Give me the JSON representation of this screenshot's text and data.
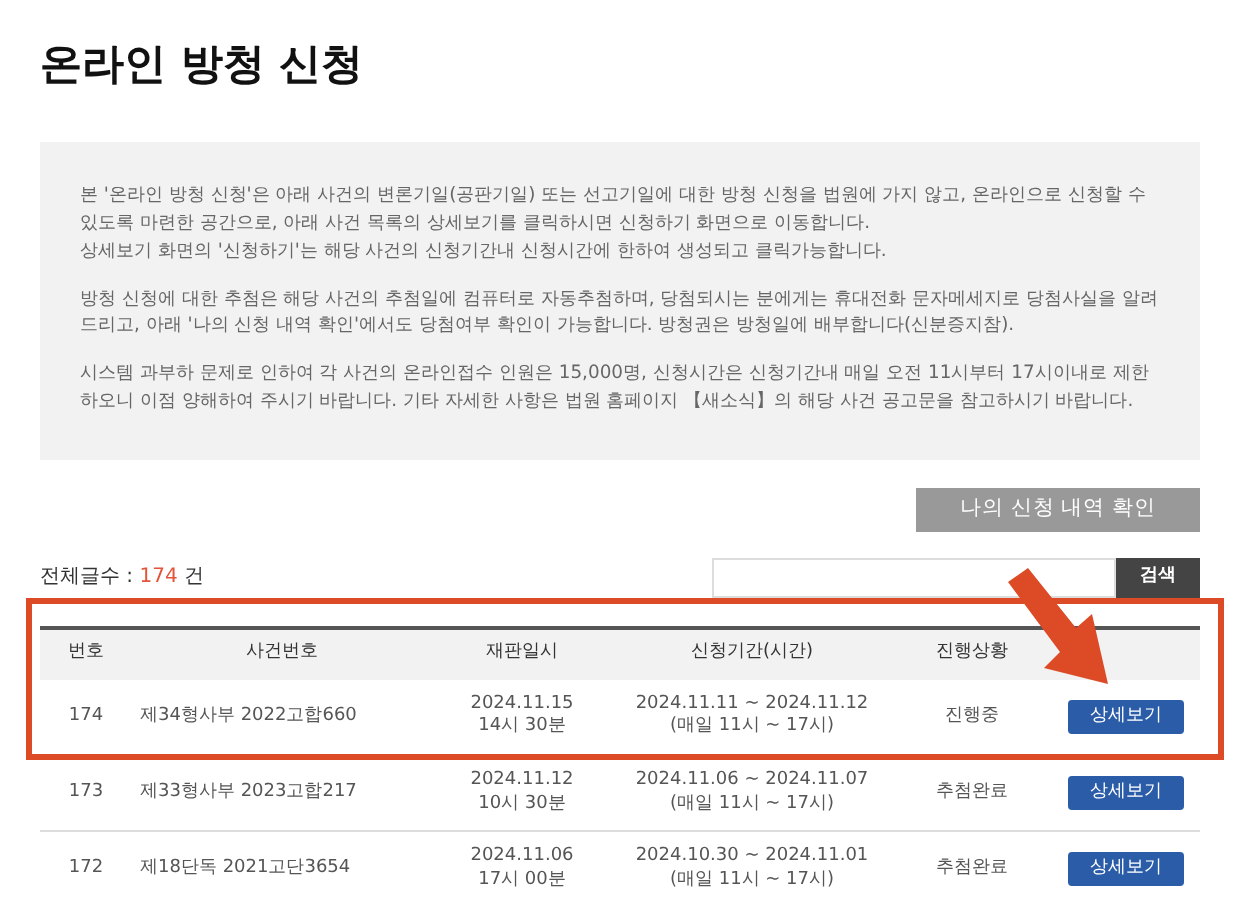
{
  "page_title": "온라인 방청 신청",
  "notice": {
    "paragraphs": [
      [
        "본 '온라인 방청 신청'은 아래 사건의 변론기일(공판기일) 또는 선고기일에 대한 방청 신청을 법원에 가지 않고, 온라인으로 신청할 수 있도록 마련한 공간으로, 아래 사건 목록의 상세보기를 클릭하시면 신청하기 화면으로 이동합니다.",
        "상세보기 화면의 '신청하기'는 해당 사건의 신청기간내 신청시간에 한하여 생성되고 클릭가능합니다."
      ],
      [
        "방청 신청에 대한 추첨은 해당 사건의 추첨일에 컴퓨터로 자동추첨하며, 당첨되시는 분에게는 휴대전화 문자메세지로 당첨사실을 알려드리고, 아래 '나의 신청 내역 확인'에서도 당첨여부 확인이 가능합니다. 방청권은 방청일에 배부합니다(신분증지참)."
      ],
      [
        "시스템 과부하 문제로 인하여 각 사건의 온라인접수 인원은 15,000명, 신청시간은 신청기간내 매일 오전 11시부터 17시이내로 제한하오니 이점 양해하여 주시기 바랍니다. 기타 자세한 사항은 법원 홈페이지 【새소식】의 해당 사건 공고문을 참고하시기 바랍니다."
      ]
    ]
  },
  "my_requests_button": "나의 신청 내역 확인",
  "total": {
    "label": "전체글수 :",
    "count": "174",
    "unit": "건"
  },
  "search": {
    "button": "검색"
  },
  "table": {
    "columns": [
      "번호",
      "사건번호",
      "재판일시",
      "신청기간(시간)",
      "진행상황"
    ],
    "rows": [
      {
        "no": "174",
        "case": "제34형사부 2022고합660",
        "trial": [
          "2024.11.15",
          "14시 30분"
        ],
        "period": [
          "2024.11.11 ~ 2024.11.12",
          "(매일 11시 ~ 17시)"
        ],
        "status": "진행중",
        "button": "상세보기"
      },
      {
        "no": "173",
        "case": "제33형사부 2023고합217",
        "trial": [
          "2024.11.12",
          "10시 30분"
        ],
        "period": [
          "2024.11.06 ~ 2024.11.07",
          "(매일 11시 ~ 17시)"
        ],
        "status": "추첨완료",
        "button": "상세보기"
      },
      {
        "no": "172",
        "case": "제18단독 2021고단3654",
        "trial": [
          "2024.11.06",
          "17시 00분"
        ],
        "period": [
          "2024.10.30 ~ 2024.11.01",
          "(매일 11시 ~ 17시)"
        ],
        "status": "추첨완료",
        "button": "상세보기"
      }
    ]
  },
  "annotation": {
    "frame": true,
    "arrow": true
  }
}
